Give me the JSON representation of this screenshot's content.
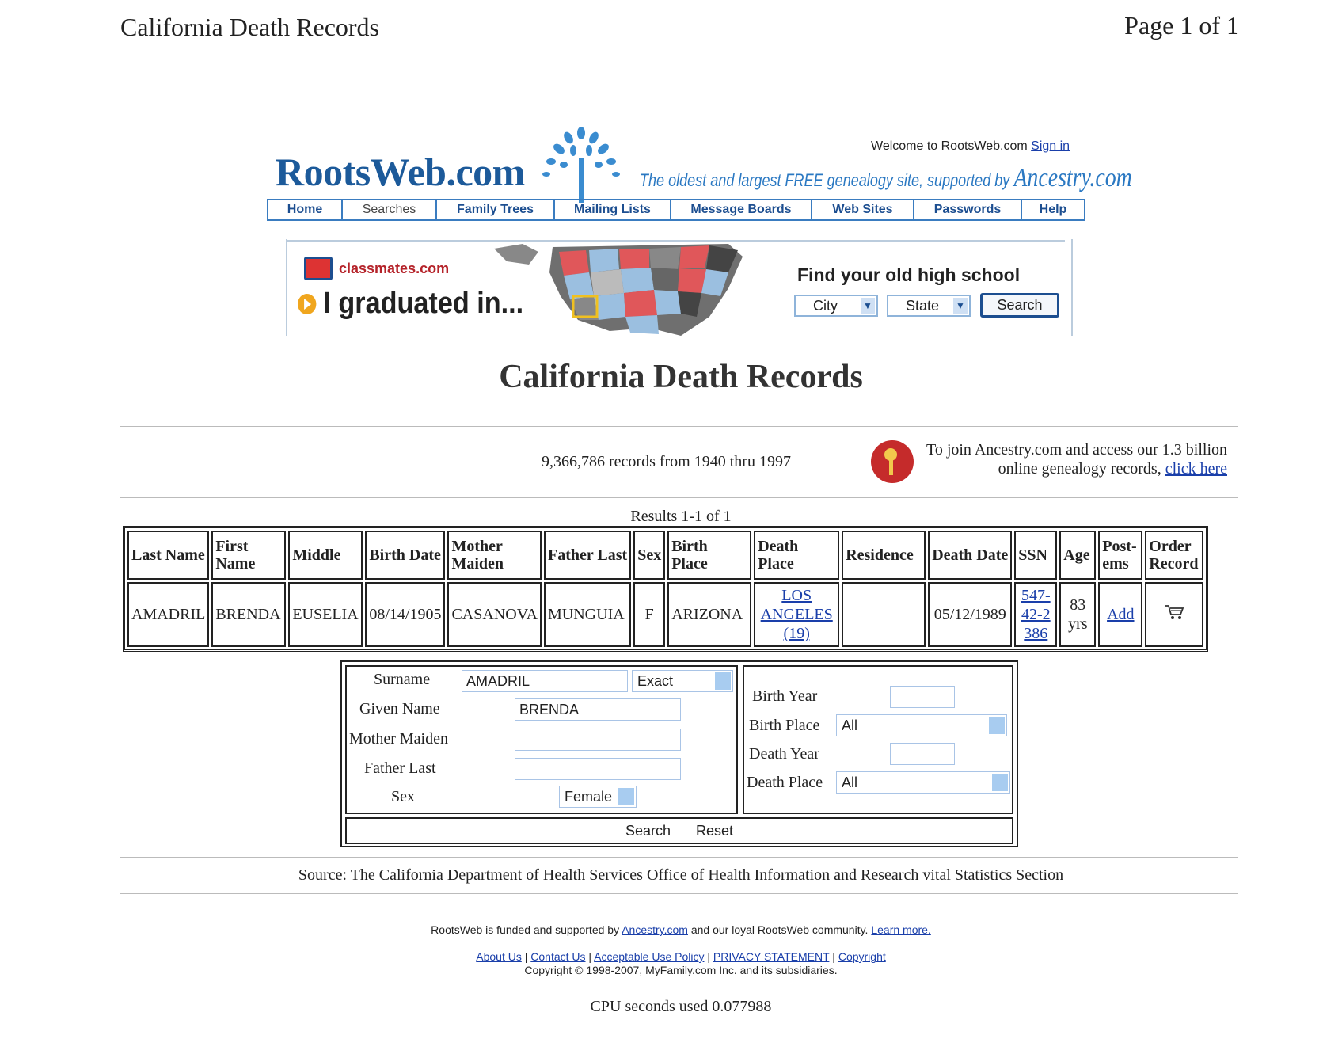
{
  "print_header": {
    "title": "California Death Records",
    "page": "Page 1 of 1"
  },
  "site": {
    "logo": "RootsWeb.com",
    "tagline": "The oldest and largest FREE genealogy site, supported by",
    "tagline_brand": "Ancestry.com",
    "welcome_text": "Welcome to RootsWeb.com",
    "sign_in": "Sign in"
  },
  "nav": [
    {
      "label": "Home"
    },
    {
      "label": "Searches"
    },
    {
      "label": "Family Trees"
    },
    {
      "label": "Mailing Lists"
    },
    {
      "label": "Message Boards"
    },
    {
      "label": "Web Sites"
    },
    {
      "label": "Passwords"
    },
    {
      "label": "Help"
    }
  ],
  "ad": {
    "brand": "classmates.com",
    "headline": "I graduated in...",
    "find_school": "Find your old high school",
    "city_label": "City",
    "state_label": "State",
    "search_label": "Search"
  },
  "page_heading": "California Death Records",
  "records_count": "9,366,786 records from 1940 thru 1997",
  "join": {
    "text": "To join Ancestry.com and access our 1.3 billion online genealogy records,",
    "link": "click here"
  },
  "results_label": "Results 1-1 of 1",
  "table": {
    "headers": [
      "Last Name",
      "First Name",
      "Middle",
      "Birth Date",
      "Mother Maiden",
      "Father Last",
      "Sex",
      "Birth Place",
      "Death Place",
      "Residence",
      "Death Date",
      "SSN",
      "Age",
      "Post-ems",
      "Order Record"
    ],
    "headers_display": [
      "Last Name",
      "First\nName",
      "Middle",
      "Birth Date",
      "Mother\nMaiden",
      "Father Last",
      "Sex",
      "Birth\nPlace",
      "Death\nPlace",
      "Residence",
      "Death Date",
      "SSN",
      "Age",
      "Post-\nems",
      "Order\nRecord"
    ],
    "rows": [
      {
        "last_name": "AMADRIL",
        "first_name": "BRENDA",
        "middle": "EUSELIA",
        "birth_date": "08/14/1905",
        "mother_maiden": "CASANOVA",
        "father_last": "MUNGUIA",
        "sex": "F",
        "birth_place": "ARIZONA",
        "death_place": "LOS ANGELES (19)",
        "residence": "",
        "death_date": "05/12/1989",
        "ssn": "547-42-2386",
        "age": "83 yrs",
        "postems": "Add",
        "order_icon": "cart-icon"
      }
    ]
  },
  "form": {
    "surname_label": "Surname",
    "surname_value": "AMADRIL",
    "surname_match": "Exact",
    "given_label": "Given Name",
    "given_value": "BRENDA",
    "mother_label": "Mother Maiden",
    "mother_value": "",
    "father_label": "Father Last",
    "father_value": "",
    "sex_label": "Sex",
    "sex_value": "Female",
    "birth_year_label": "Birth Year",
    "birth_year_value": "",
    "birth_place_label": "Birth Place",
    "birth_place_value": "All",
    "death_year_label": "Death Year",
    "death_year_value": "",
    "death_place_label": "Death Place",
    "death_place_value": "All",
    "search_label": "Search",
    "reset_label": "Reset"
  },
  "source": "Source: The California Department of Health Services Office of Health Information and Research vital Statistics Section",
  "footer": {
    "funded_pre": "RootsWeb is funded and supported by",
    "funded_link": "Ancestry.com",
    "funded_post": "and our loyal RootsWeb community.",
    "learn_more": "Learn more.",
    "links": [
      "About Us",
      "Contact Us",
      "Acceptable Use Policy",
      "PRIVACY STATEMENT",
      "Copyright"
    ],
    "copyright": "Copyright © 1998-2007, MyFamily.com Inc. and its subsidiaries."
  },
  "cpu": "CPU seconds used 0.077988",
  "colors": {
    "brand_blue": "#1c5a9a",
    "link": "#1a3faa",
    "nav_border": "#3a7cc0"
  }
}
